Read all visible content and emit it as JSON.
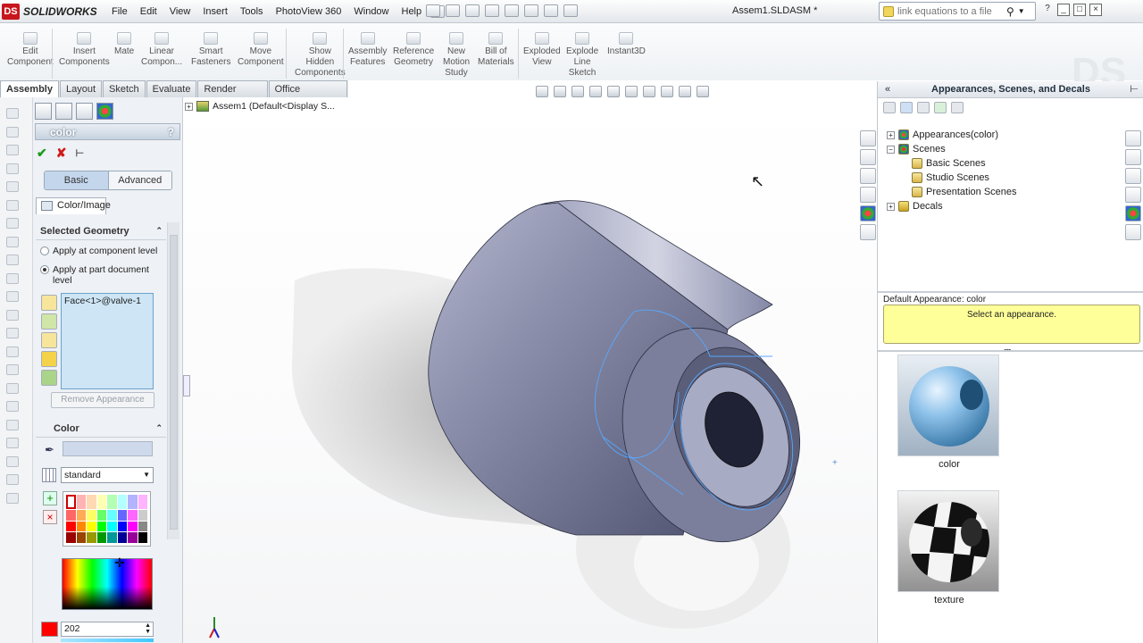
{
  "app": {
    "name": "SOLIDWORKS",
    "doc_title": "Assem1.SLDASM *"
  },
  "menu": [
    "File",
    "Edit",
    "View",
    "Insert",
    "Tools",
    "PhotoView 360",
    "Window",
    "Help"
  ],
  "search": {
    "placeholder": "link equations to a file"
  },
  "commands": [
    {
      "label": "Edit\nComponent"
    },
    {
      "label": "Insert\nComponents"
    },
    {
      "label": "Mate"
    },
    {
      "label": "Linear\nCompon..."
    },
    {
      "label": "Smart\nFasteners"
    },
    {
      "label": "Move\nComponent"
    },
    {
      "label": "Show\nHidden\nComponents"
    },
    {
      "label": "Assembly\nFeatures"
    },
    {
      "label": "Reference\nGeometry"
    },
    {
      "label": "New\nMotion\nStudy"
    },
    {
      "label": "Bill of\nMaterials"
    },
    {
      "label": "Exploded\nView"
    },
    {
      "label": "Explode\nLine\nSketch"
    },
    {
      "label": "Instant3D"
    }
  ],
  "tabs": [
    "Assembly",
    "Layout",
    "Sketch",
    "Evaluate",
    "Render Tools",
    "Office Products"
  ],
  "property_manager": {
    "title": "color",
    "help": "?",
    "modes": {
      "basic": "Basic",
      "advanced": "Advanced"
    },
    "color_image_tab": "Color/Image",
    "selected_geometry": {
      "heading": "Selected Geometry",
      "option_component": "Apply at component level",
      "option_part": "Apply at part document level",
      "selection": "Face<1>@valve-1",
      "remove_button": "Remove Appearance"
    },
    "color": {
      "heading": "Color",
      "palette": "standard",
      "value": "202"
    }
  },
  "graphics": {
    "tree_root": "Assem1  (Default<Display S..."
  },
  "task_pane": {
    "title": "Appearances, Scenes, and Decals",
    "tree": [
      {
        "label": "Appearances(color)",
        "level": 0,
        "expander": "+"
      },
      {
        "label": "Scenes",
        "level": 0,
        "expander": "−"
      },
      {
        "label": "Basic Scenes",
        "level": 1
      },
      {
        "label": "Studio Scenes",
        "level": 1
      },
      {
        "label": "Presentation Scenes",
        "level": 1
      },
      {
        "label": "Decals",
        "level": 0,
        "expander": "+"
      }
    ],
    "default_appearance": "Default Appearance: color",
    "tip": "Select an appearance.",
    "thumbnails": [
      {
        "label": "color"
      },
      {
        "label": "texture"
      }
    ]
  },
  "colors": {
    "accent_red": "#c8161d",
    "selection_fill": "#cde5f5",
    "tip_yellow": "#ffff99",
    "swatch_red": "#ff0000"
  }
}
